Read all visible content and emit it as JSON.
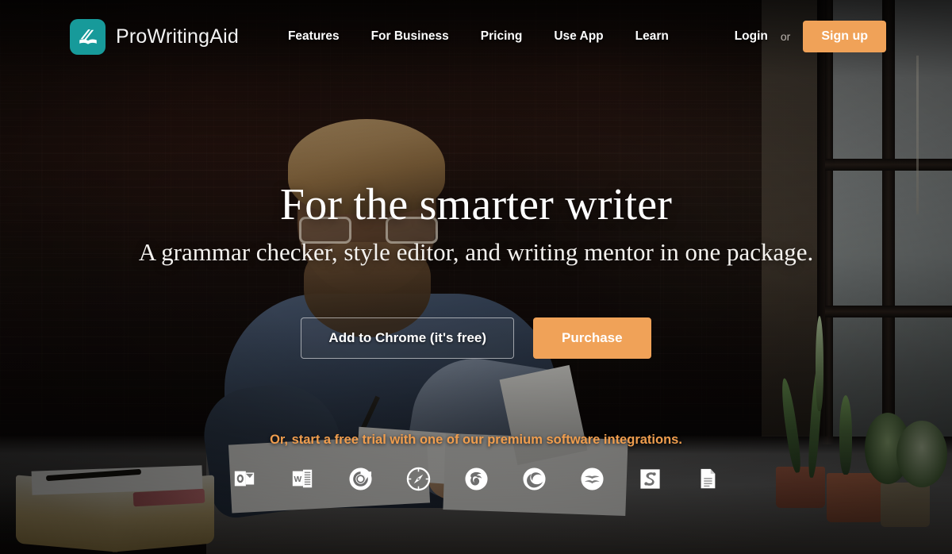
{
  "brand": {
    "name": "ProWritingAid",
    "logo_icon": "book-checkmark-logo-icon",
    "logo_color": "#179a9a"
  },
  "nav": {
    "items": [
      {
        "label": "Features"
      },
      {
        "label": "For Business"
      },
      {
        "label": "Pricing"
      },
      {
        "label": "Use App"
      },
      {
        "label": "Learn"
      }
    ],
    "login_label": "Login",
    "or_label": "or",
    "signup_label": "Sign up"
  },
  "hero": {
    "headline": "For the smarter writer",
    "subheadline": "A grammar checker, style editor, and writing mentor in one package.",
    "primary_cta": "Add to Chrome (it's free)",
    "secondary_cta": "Purchase",
    "trial_note": "Or, start a free trial with one of our premium software integrations."
  },
  "integrations": [
    {
      "name": "outlook-icon",
      "label": "Microsoft Outlook"
    },
    {
      "name": "word-icon",
      "label": "Microsoft Word"
    },
    {
      "name": "chrome-icon",
      "label": "Google Chrome"
    },
    {
      "name": "safari-icon",
      "label": "Safari"
    },
    {
      "name": "firefox-icon",
      "label": "Mozilla Firefox"
    },
    {
      "name": "edge-icon",
      "label": "Microsoft Edge"
    },
    {
      "name": "openoffice-icon",
      "label": "Open Office"
    },
    {
      "name": "scrivener-icon",
      "label": "Scrivener"
    },
    {
      "name": "googledocs-icon",
      "label": "Google Docs"
    }
  ],
  "colors": {
    "accent_orange": "#f0a258",
    "brand_teal": "#179a9a",
    "trial_text": "#ef9d4e"
  }
}
